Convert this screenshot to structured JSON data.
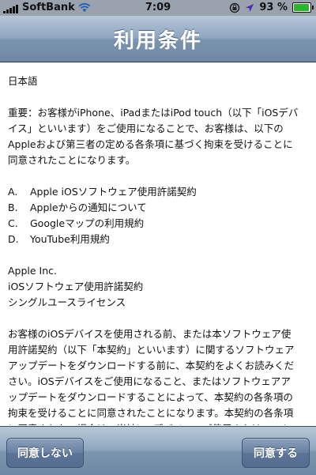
{
  "status": {
    "carrier": "SoftBank",
    "time": "7:09",
    "battery_percent": "93 %",
    "battery_level": 0.93
  },
  "nav": {
    "title": "利用条件"
  },
  "content": {
    "language": "日本語",
    "intro": "重要：お客様がiPhone、iPadまたはiPod touch（以下「iOSデバイス」といいます）をご使用になることで、お客様は、以下のAppleおよび第三者の定める各条項に基づく拘束を受けることに同意されたことになります。",
    "items": [
      {
        "marker": "A.",
        "text": "Apple iOSソフトウェア使用許諾契約"
      },
      {
        "marker": "B.",
        "text": "Appleからの通知について"
      },
      {
        "marker": "C.",
        "text": "Googleマップの利用規約"
      },
      {
        "marker": "D.",
        "text": "YouTube利用規約"
      }
    ],
    "company": "Apple Inc.",
    "license_title": "iOSソフトウェア使用許諾契約",
    "license_type": "シングルユースライセンス",
    "body": "お客様のiOSデバイスを使用される前、または本ソフトウェア使用許諾契約（以下「本契約」といいます）に関するソフトウェアアップデートをダウンロードする前に、本契約をよくお読みください。iOSデバイスをご使用になること、またはソフトウェアアップデートをダウンロードすることによって、本契約の各条項の拘束を受けることに同意されたことになります。本契約の各条項に同意されない場合は、当該iOSデバイスのご使用またはソフトウェアアップデ"
  },
  "toolbar": {
    "decline_label": "同意しない",
    "accept_label": "同意する"
  }
}
